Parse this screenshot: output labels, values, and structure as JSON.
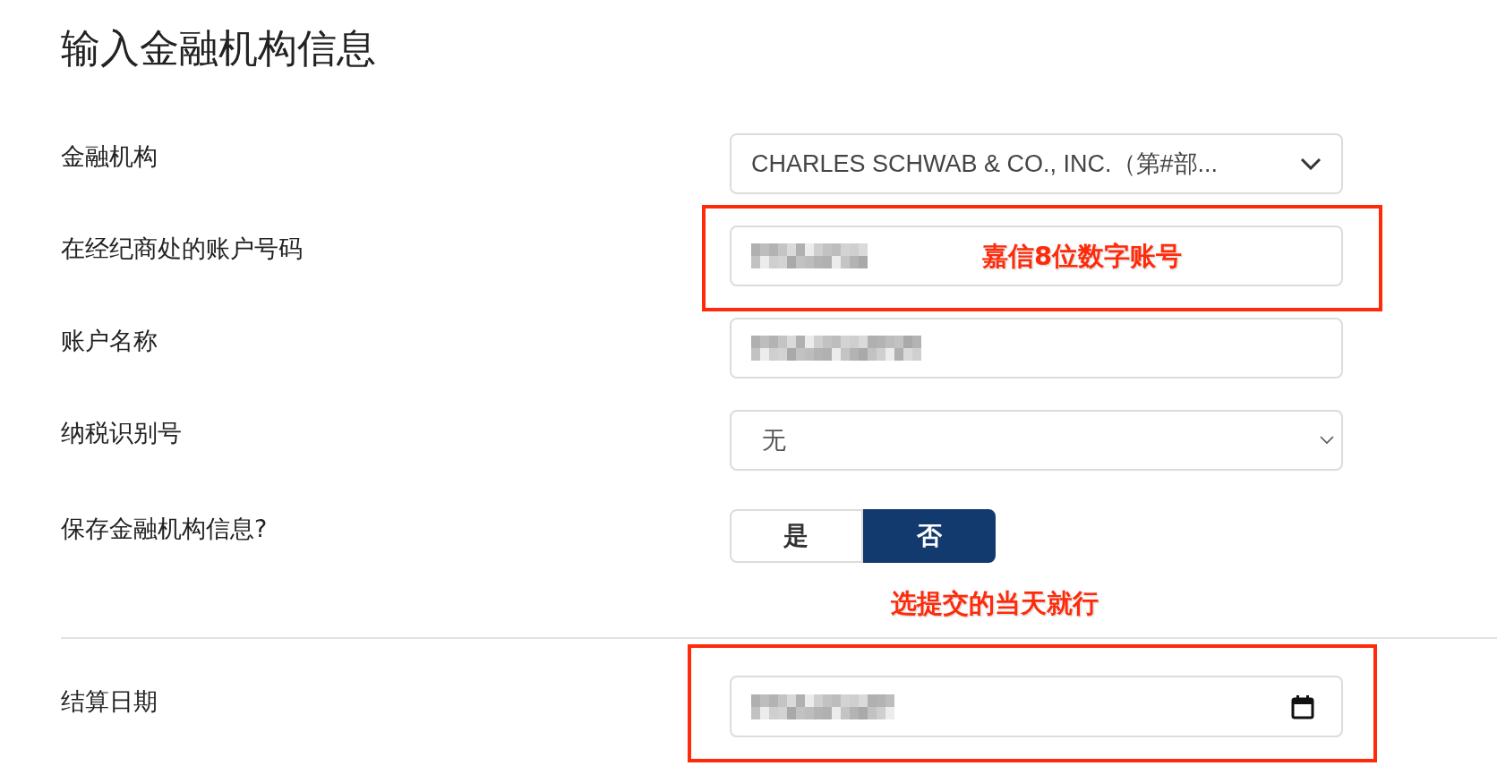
{
  "title": "输入金融机构信息",
  "fields": [
    {
      "label": "金融机构",
      "kind": "select",
      "value": "CHARLES SCHWAB & CO., INC.（第#部..."
    },
    {
      "label": "在经纪商处的账户号码",
      "kind": "redacted"
    },
    {
      "label": "账户名称",
      "kind": "redacted"
    },
    {
      "label": "纳税识别号",
      "kind": "native-select",
      "value": "无"
    },
    {
      "label": "保存金融机构信息?",
      "kind": "toggle",
      "options": [
        {
          "label": "是",
          "selected": false
        },
        {
          "label": "否",
          "selected": true
        }
      ]
    }
  ],
  "settlement": {
    "label": "结算日期",
    "kind": "date"
  },
  "annotations": [
    {
      "text": "嘉信8位数字账号"
    },
    {
      "text": "选提交的当天就行"
    }
  ]
}
